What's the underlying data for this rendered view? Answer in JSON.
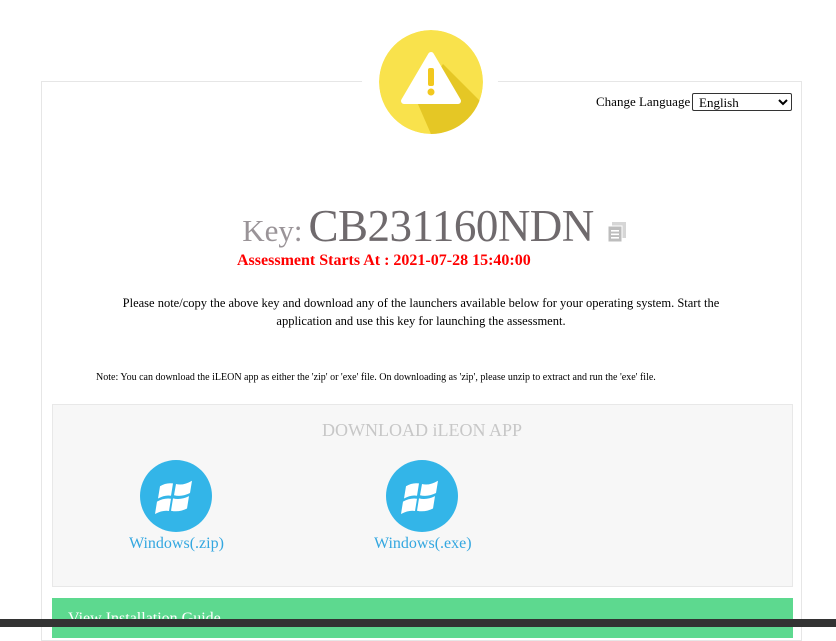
{
  "header": {
    "warning_icon": "warning-triangle-icon",
    "accent_yellow": "#f9e24c"
  },
  "language": {
    "label": "Change Language",
    "selected": "English"
  },
  "key": {
    "label": "Key:",
    "value": "CB231160NDN",
    "copy_icon": "copy-icon"
  },
  "assessment": {
    "starts_text": "Assessment Starts At : 2021-07-28 15:40:00",
    "color": "#ff0000"
  },
  "instructions": "Please note/copy the above key and download any of the launchers available below for your operating system. Start the application and use this key for launching the assessment.",
  "note": "Note: You can download the iLEON app as either the 'zip' or 'exe' file. On downloading as 'zip', please unzip to extract and run the 'exe' file.",
  "download": {
    "title": "DOWNLOAD iLEON APP",
    "items": [
      {
        "label": "Windows(.zip)",
        "icon": "windows-icon"
      },
      {
        "label": "Windows(.exe)",
        "icon": "windows-icon"
      }
    ]
  },
  "guide": {
    "label": "View Installation Guide",
    "color": "#5dd98f"
  }
}
